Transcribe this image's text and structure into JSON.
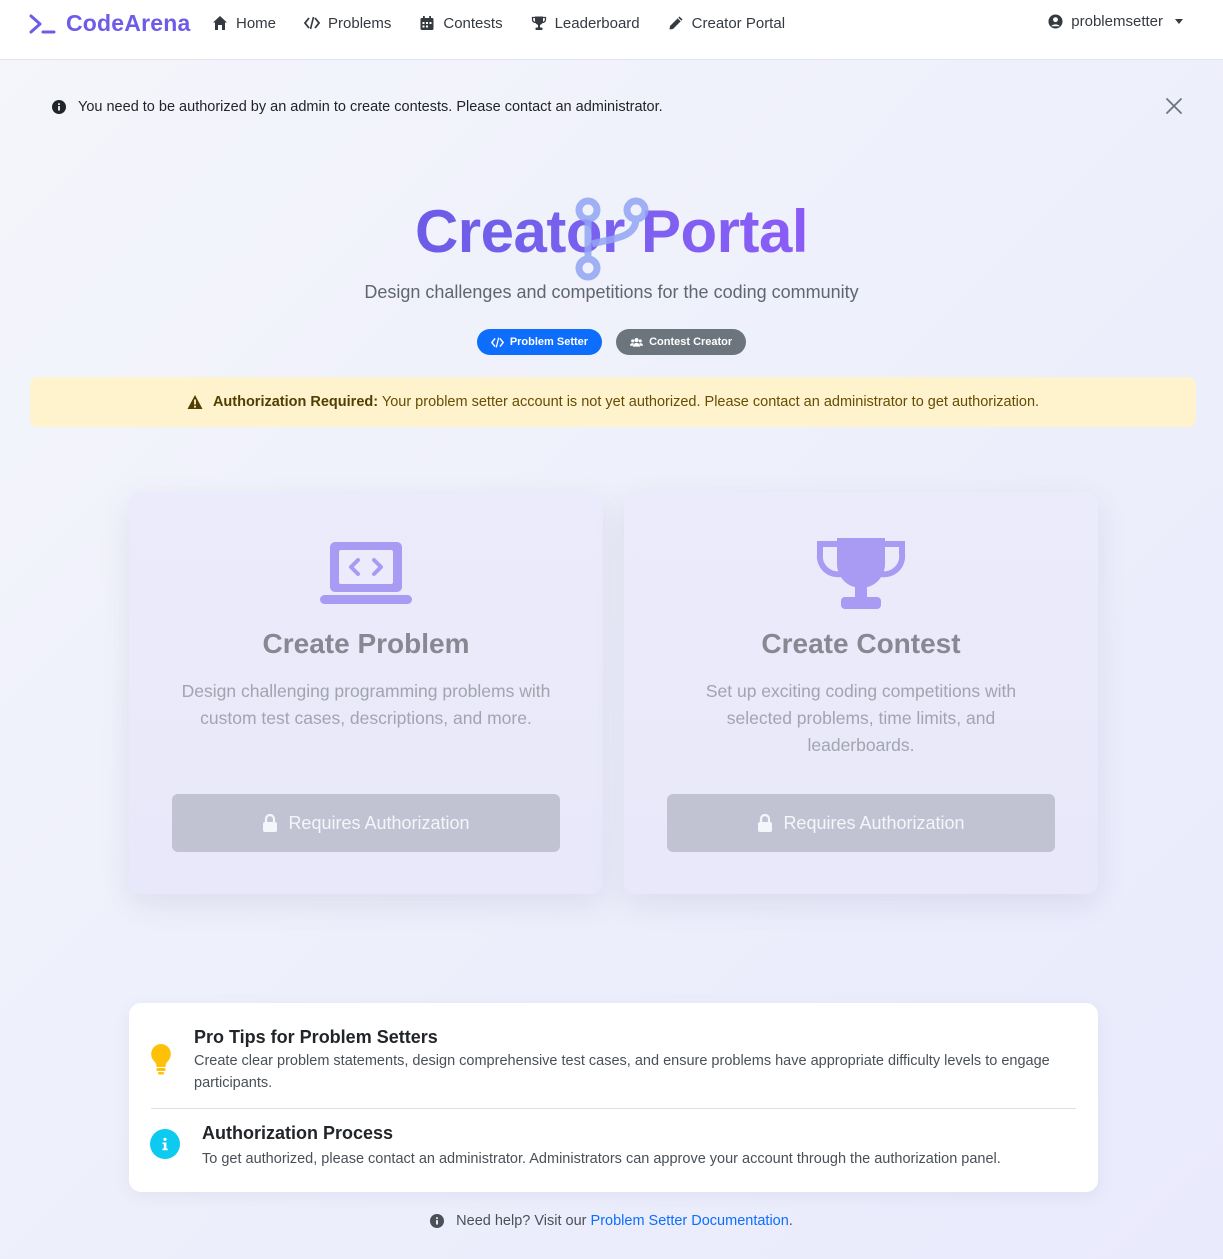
{
  "navbar": {
    "brand": "CodeArena",
    "items": [
      {
        "label": "Home",
        "icon": "home-icon"
      },
      {
        "label": "Problems",
        "icon": "code-icon"
      },
      {
        "label": "Contests",
        "icon": "calendar-icon"
      },
      {
        "label": "Leaderboard",
        "icon": "trophy-icon"
      },
      {
        "label": "Creator Portal",
        "icon": "pencil-icon"
      }
    ],
    "user": "problemsetter"
  },
  "info_alert": {
    "text": "You need to be authorized by an admin to create contests. Please contact an administrator."
  },
  "hero": {
    "title": "Creator Portal",
    "subtitle": "Design challenges and competitions for the coding community",
    "badges": [
      "Problem Setter",
      "Contest Creator"
    ]
  },
  "warning": {
    "strong": "Authorization Required:",
    "text": "Your problem setter account is not yet authorized. Please contact an administrator to get authorization."
  },
  "cards": [
    {
      "icon": "laptop-code-icon",
      "title": "Create Problem",
      "desc": "Design challenging programming problems with custom test cases, descriptions, and more.",
      "button": "Requires Authorization"
    },
    {
      "icon": "trophy-icon",
      "title": "Create Contest",
      "desc": "Set up exciting coding competitions with selected problems, time limits, and leaderboards.",
      "button": "Requires Authorization"
    }
  ],
  "tips": [
    {
      "icon": "lightbulb-icon",
      "title": "Pro Tips for Problem Setters",
      "text": "Create clear problem statements, design comprehensive test cases, and ensure problems have appropriate difficulty levels to engage participants."
    },
    {
      "icon": "info-icon",
      "title": "Authorization Process",
      "text": "To get authorized, please contact an administrator. Administrators can approve your account through the authorization panel."
    }
  ],
  "help": {
    "prefix": "Need help? Visit our",
    "link": "Problem Setter Documentation",
    "suffix": "."
  },
  "colors": {
    "brand": "#6c5ce7",
    "badge_primary": "#0d6efd",
    "badge_secondary": "#6c757d",
    "warning_bg": "#fff3cd",
    "info": "#0dcaf0",
    "bulb": "#ffc107"
  }
}
